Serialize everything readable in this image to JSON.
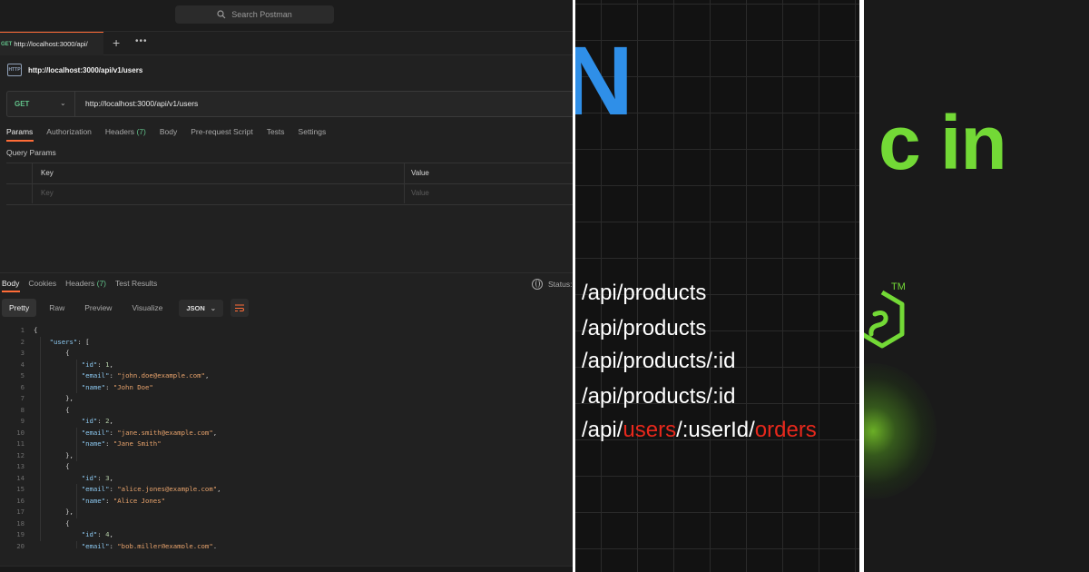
{
  "postman": {
    "search_placeholder": "Search Postman",
    "tab": {
      "method": "GET",
      "label": "http://localhost:3000/api/"
    },
    "tab_add": "+",
    "tab_more": "•••",
    "request_title": "http://localhost:3000/api/v1/users",
    "method": "GET",
    "url": "http://localhost:3000/api/v1/users",
    "request_tabs": [
      {
        "label": "Params"
      },
      {
        "label": "Authorization"
      },
      {
        "label": "Headers",
        "count": "(7)"
      },
      {
        "label": "Body"
      },
      {
        "label": "Pre-request Script"
      },
      {
        "label": "Tests"
      },
      {
        "label": "Settings"
      }
    ],
    "query_params_label": "Query Params",
    "table": {
      "key_header": "Key",
      "value_header": "Value",
      "key_placeholder": "Key",
      "value_placeholder": "Value"
    },
    "response_tabs": [
      {
        "label": "Body"
      },
      {
        "label": "Cookies"
      },
      {
        "label": "Headers",
        "count": "(7)"
      },
      {
        "label": "Test Results"
      }
    ],
    "status_label": "Status:",
    "view_buttons": [
      "Pretty",
      "Raw",
      "Preview",
      "Visualize"
    ],
    "format": "JSON",
    "code_lines": [
      [
        [
          "p",
          "{"
        ]
      ],
      [
        [
          "p",
          "    "
        ],
        [
          "k",
          "\"users\""
        ],
        [
          "p",
          ": ["
        ]
      ],
      [
        [
          "p",
          "        {"
        ]
      ],
      [
        [
          "p",
          "            "
        ],
        [
          "k",
          "\"id\""
        ],
        [
          "p",
          ": "
        ],
        [
          "n",
          "1"
        ],
        [
          "p",
          ","
        ]
      ],
      [
        [
          "p",
          "            "
        ],
        [
          "k",
          "\"email\""
        ],
        [
          "p",
          ": "
        ],
        [
          "s",
          "\"john.doe@example.com\""
        ],
        [
          "p",
          ","
        ]
      ],
      [
        [
          "p",
          "            "
        ],
        [
          "k",
          "\"name\""
        ],
        [
          "p",
          ": "
        ],
        [
          "s",
          "\"John Doe\""
        ]
      ],
      [
        [
          "p",
          "        },"
        ]
      ],
      [
        [
          "p",
          "        {"
        ]
      ],
      [
        [
          "p",
          "            "
        ],
        [
          "k",
          "\"id\""
        ],
        [
          "p",
          ": "
        ],
        [
          "n",
          "2"
        ],
        [
          "p",
          ","
        ]
      ],
      [
        [
          "p",
          "            "
        ],
        [
          "k",
          "\"email\""
        ],
        [
          "p",
          ": "
        ],
        [
          "s",
          "\"jane.smith@example.com\""
        ],
        [
          "p",
          ","
        ]
      ],
      [
        [
          "p",
          "            "
        ],
        [
          "k",
          "\"name\""
        ],
        [
          "p",
          ": "
        ],
        [
          "s",
          "\"Jane Smith\""
        ]
      ],
      [
        [
          "p",
          "        },"
        ]
      ],
      [
        [
          "p",
          "        {"
        ]
      ],
      [
        [
          "p",
          "            "
        ],
        [
          "k",
          "\"id\""
        ],
        [
          "p",
          ": "
        ],
        [
          "n",
          "3"
        ],
        [
          "p",
          ","
        ]
      ],
      [
        [
          "p",
          "            "
        ],
        [
          "k",
          "\"email\""
        ],
        [
          "p",
          ": "
        ],
        [
          "s",
          "\"alice.jones@example.com\""
        ],
        [
          "p",
          ","
        ]
      ],
      [
        [
          "p",
          "            "
        ],
        [
          "k",
          "\"name\""
        ],
        [
          "p",
          ": "
        ],
        [
          "s",
          "\"Alice Jones\""
        ]
      ],
      [
        [
          "p",
          "        },"
        ]
      ],
      [
        [
          "p",
          "        {"
        ]
      ],
      [
        [
          "p",
          "            "
        ],
        [
          "k",
          "\"id\""
        ],
        [
          "p",
          ": "
        ],
        [
          "n",
          "4"
        ],
        [
          "p",
          ","
        ]
      ],
      [
        [
          "p",
          "            "
        ],
        [
          "k",
          "\"email\""
        ],
        [
          "p",
          ": "
        ],
        [
          "s",
          "\"bob.miller@example.com\""
        ],
        [
          "p",
          ","
        ]
      ]
    ]
  },
  "routes_panel": {
    "big_letter": "N",
    "routes": [
      [
        {
          "t": "/api/products",
          "c": "white"
        }
      ],
      [
        {
          "t": "/api/products",
          "c": "white"
        }
      ],
      [
        {
          "t": "/api/products/:id",
          "c": "white"
        }
      ],
      [
        {
          "t": "/api/products/:id",
          "c": "white"
        }
      ],
      [
        {
          "t": "/api/",
          "c": "white"
        },
        {
          "t": "users",
          "c": "red"
        },
        {
          "t": "/:userId/",
          "c": "white"
        },
        {
          "t": "orders",
          "c": "red"
        }
      ]
    ]
  },
  "node_panel": {
    "heading_fragment": "c in",
    "trademark": "TM"
  },
  "colors": {
    "postman_bg": "#212121",
    "postman_accent": "#ff6c37",
    "get_green": "#62c28a",
    "routes_blue": "#2f8fe8",
    "route_red": "#e8281c",
    "node_green": "#73d936"
  }
}
